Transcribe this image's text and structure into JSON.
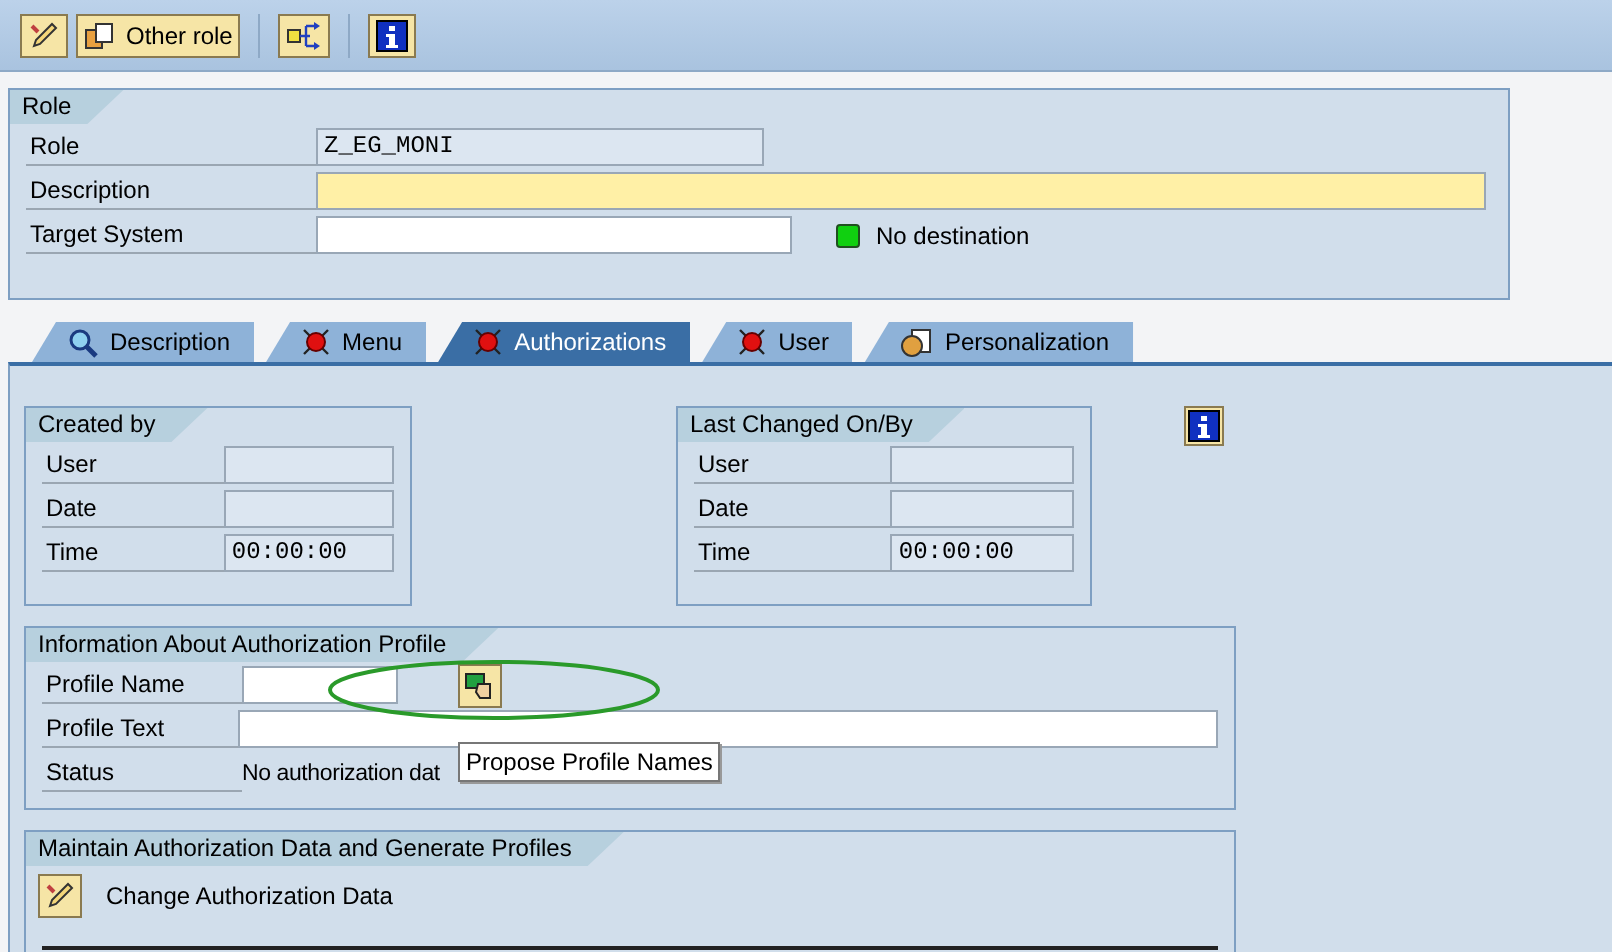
{
  "toolbar": {
    "other_role_button": "Other role"
  },
  "role_panel": {
    "title": "Role",
    "fields": [
      {
        "label": "Role",
        "kind": "readonly",
        "value": "Z_EG_MONI"
      },
      {
        "label": "Description",
        "kind": "required"
      },
      {
        "label": "Target System",
        "kind": "input",
        "status": "No destination"
      }
    ]
  },
  "tabs": [
    {
      "label": "Description",
      "selected": false
    },
    {
      "label": "Menu",
      "selected": false
    },
    {
      "label": "Authorizations",
      "selected": true
    },
    {
      "label": "User",
      "selected": false
    },
    {
      "label": "Personalization",
      "selected": false
    }
  ],
  "created_by": {
    "title": "Created by",
    "fields": [
      {
        "label": "User",
        "kind": "readonly"
      },
      {
        "label": "Date",
        "kind": "readonly"
      },
      {
        "label": "Time",
        "kind": "readonly",
        "value": "00:00:00"
      }
    ]
  },
  "last_changed": {
    "title": "Last Changed On/By",
    "fields": [
      {
        "label": "User",
        "kind": "readonly"
      },
      {
        "label": "Date",
        "kind": "readonly"
      },
      {
        "label": "Time",
        "kind": "readonly",
        "value": "00:00:00"
      }
    ]
  },
  "profile_info": {
    "title": "Information About Authorization Profile",
    "fields": [
      {
        "label": "Profile Name",
        "kind": "input"
      },
      {
        "label": "Profile Text",
        "kind": "input"
      },
      {
        "label": "Status",
        "kind": "text",
        "value": "No authorization dat"
      }
    ],
    "tooltip": "Propose Profile Names"
  },
  "maintain": {
    "title": "Maintain Authorization Data and Generate Profiles",
    "action": "Change Authorization Data"
  }
}
